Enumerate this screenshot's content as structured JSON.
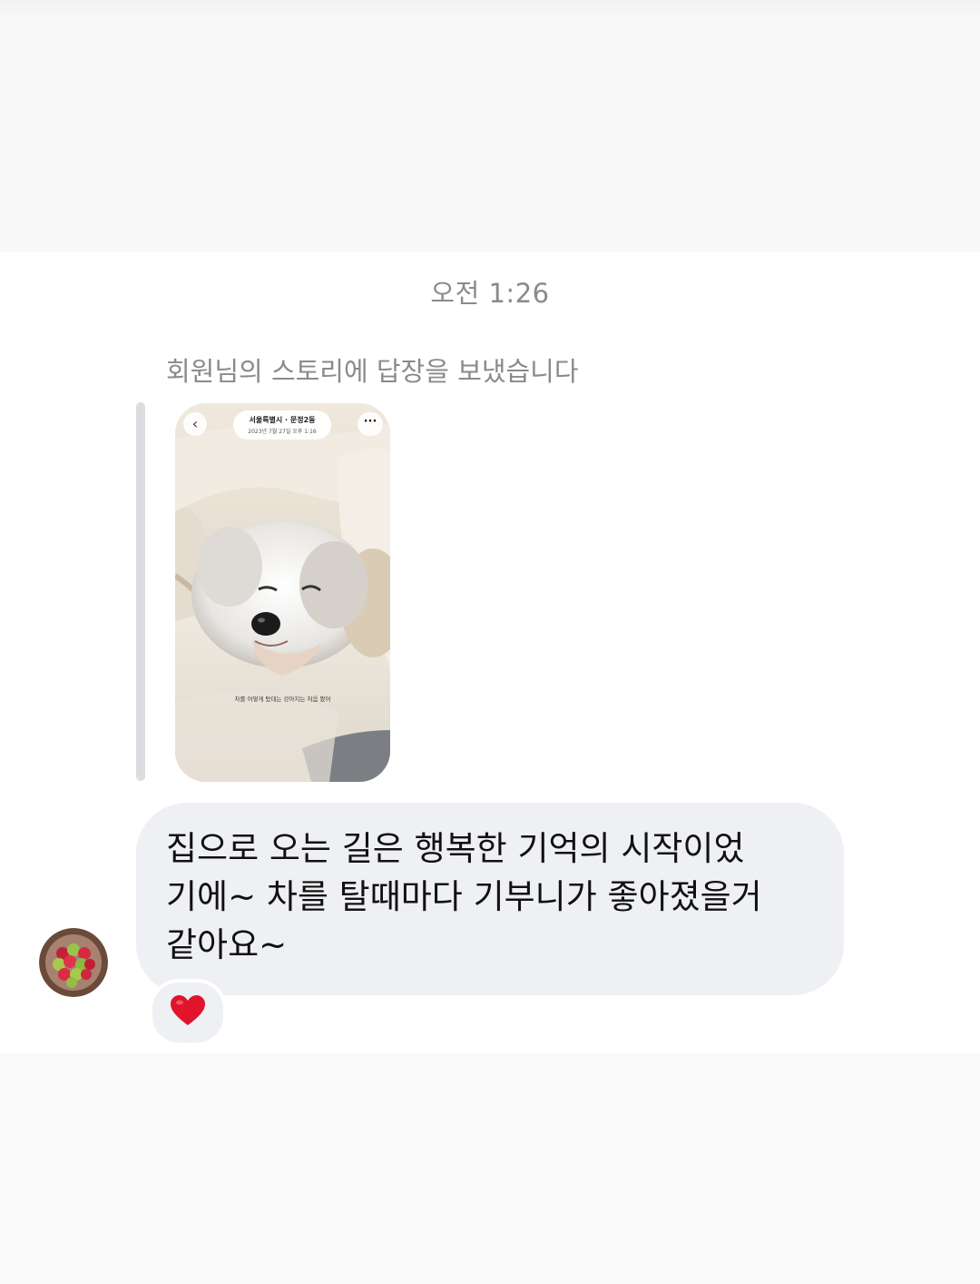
{
  "chat": {
    "timestamp": "오전 1:26",
    "reply_note": "회원님의 스토리에 답장을 보냈습니다",
    "story": {
      "location": "서울특별시 · 문정2동",
      "date": "2023년 7월 27일  오후 1:16",
      "caption": "차를 어떻게 탔대는 강아지는 처음 봤어",
      "back_icon": "chevron-left-icon",
      "more_icon": "more-horizontal-icon"
    },
    "message": {
      "lines": [
        "집으로 오는 길은 행복한 기억의 시작이었",
        "기에~ 차를 탈때마다 기부니가 좋아졌을거",
        "같아요~"
      ]
    },
    "reaction": {
      "icon": "red-heart-icon",
      "color": "#e0142b"
    },
    "colors": {
      "bubble": "#eef0f4",
      "meta_text": "#8a8a8a",
      "quote_bar": "#dcdde0"
    }
  }
}
